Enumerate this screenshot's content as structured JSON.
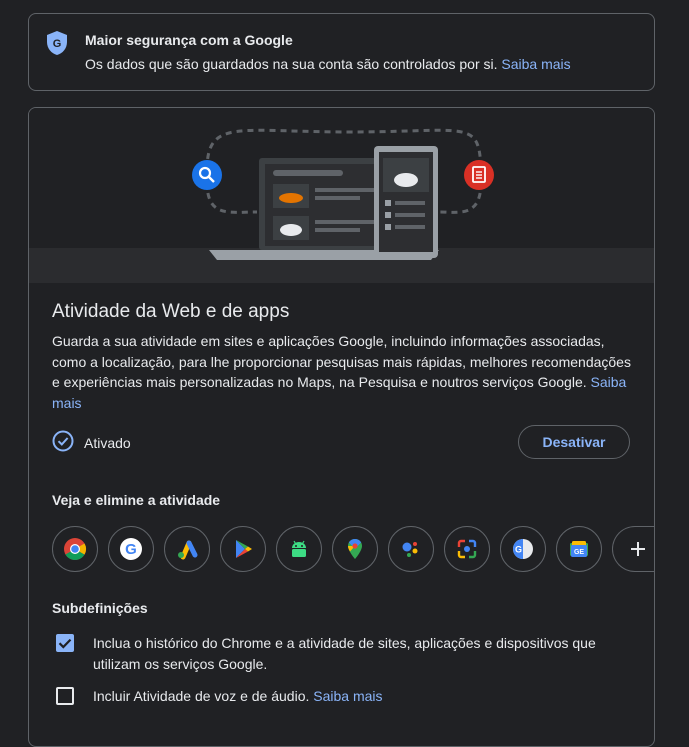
{
  "security": {
    "title": "Maior segurança com a Google",
    "text": "Os dados que são guardados na sua conta são controlados por si.",
    "link": "Saiba mais"
  },
  "activity": {
    "title": "Atividade da Web e de apps",
    "description": "Guarda a sua atividade em sites e aplicações Google, incluindo informações associadas, como a localização, para lhe proporcionar pesquisas mais rápidas, melhores recomendações e experiências mais personalizadas no Maps, na Pesquisa e noutros serviços Google.",
    "link": "Saiba mais",
    "status": "Ativado",
    "disable_button": "Desativar"
  },
  "view_delete": {
    "heading": "Veja e elimine a atividade",
    "apps": [
      "chrome-icon",
      "google-icon",
      "google-ads-icon",
      "google-play-icon",
      "android-icon",
      "google-maps-icon",
      "google-assistant-icon",
      "google-lens-icon",
      "google-translate-icon",
      "google-news-icon",
      "add-icon"
    ]
  },
  "subsettings": {
    "heading": "Subdefinições",
    "items": [
      {
        "label": "Inclua o histórico do Chrome e a atividade de sites, aplicações e dispositivos que utilizam os serviços Google.",
        "checked": true
      },
      {
        "label": "Incluir Atividade de voz e de áudio.",
        "link": "Saiba mais",
        "checked": false
      }
    ]
  },
  "colors": {
    "background": "#202124",
    "link": "#8ab4f8",
    "border": "#5f6368"
  }
}
